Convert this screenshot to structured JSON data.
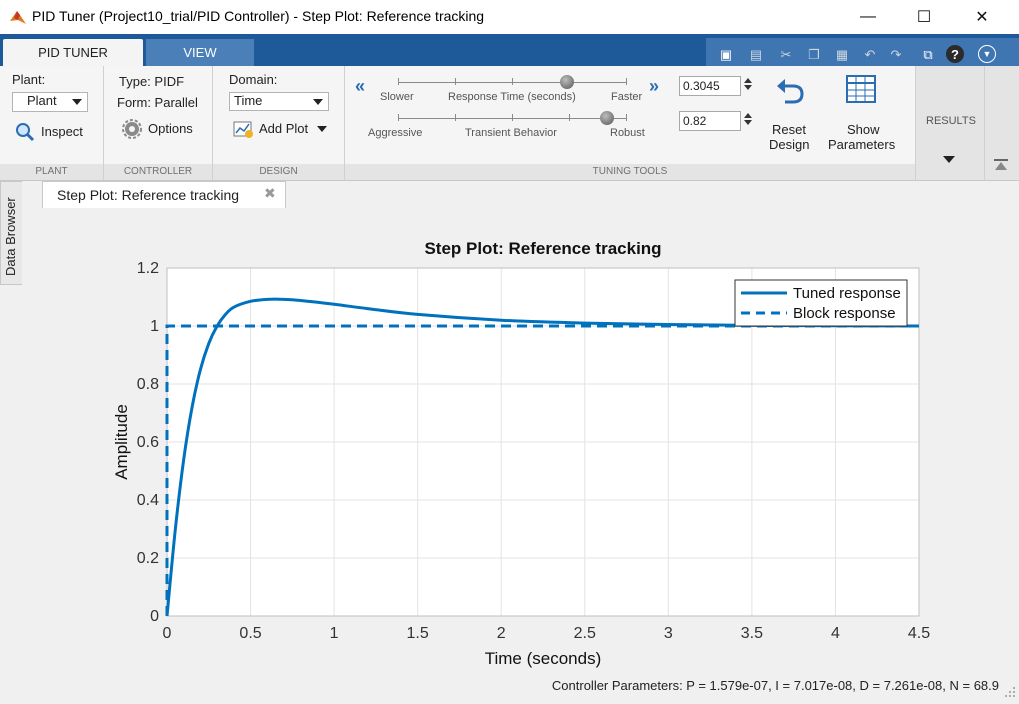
{
  "window": {
    "title": "PID Tuner (Project10_trial/PID Controller) - Step Plot: Reference tracking",
    "minimize": "—",
    "maximize": "☐",
    "close": "✕"
  },
  "tabs": {
    "pid_tuner": "PID TUNER",
    "view": "VIEW"
  },
  "plant": {
    "label": "Plant:",
    "value": "Plant",
    "inspect": "Inspect",
    "section": "PLANT"
  },
  "controller": {
    "type": "Type: PIDF",
    "form": "Form: Parallel",
    "options": "Options",
    "section": "CONTROLLER"
  },
  "design": {
    "domain_label": "Domain:",
    "domain_value": "Time",
    "add_plot": "Add Plot",
    "section": "DESIGN"
  },
  "tuning": {
    "slower": "Slower",
    "response_time": "Response Time (seconds)",
    "faster": "Faster",
    "aggressive": "Aggressive",
    "transient_behavior": "Transient Behavior",
    "robust": "Robust",
    "response_value": "0.3045",
    "transient_value": "0.82",
    "reset_design_1": "Reset",
    "reset_design_2": "Design",
    "show_params_1": "Show",
    "show_params_2": "Parameters",
    "section": "TUNING TOOLS"
  },
  "results": {
    "label": "RESULTS"
  },
  "data_browser": "Data Browser",
  "doc_tab": "Step Plot: Reference tracking",
  "controller_parameters": "Controller Parameters: P = 1.579e-07, I = 7.017e-08, D = 7.261e-08, N = 68.9",
  "colors": {
    "accent": "#1e5a9a",
    "series": "#0072bd"
  },
  "chart_data": {
    "type": "line",
    "title": "Step Plot: Reference tracking",
    "xlabel": "Time (seconds)",
    "ylabel": "Amplitude",
    "xlim": [
      0,
      4.5
    ],
    "ylim": [
      0,
      1.2
    ],
    "xticks": [
      "0",
      "0.5",
      "1",
      "1.5",
      "2",
      "2.5",
      "3",
      "3.5",
      "4",
      "4.5"
    ],
    "yticks": [
      "0",
      "0.2",
      "0.4",
      "0.6",
      "0.8",
      "1",
      "1.2"
    ],
    "grid": true,
    "legend_position": "top-right",
    "series": [
      {
        "name": "Tuned response",
        "style": "solid",
        "x": [
          0,
          0.05,
          0.1,
          0.15,
          0.2,
          0.25,
          0.3,
          0.35,
          0.4,
          0.5,
          0.6,
          0.7,
          0.8,
          1.0,
          1.2,
          1.5,
          2.0,
          2.5,
          3.0,
          3.5,
          4.0,
          4.5
        ],
        "y": [
          0,
          0.3,
          0.54,
          0.72,
          0.85,
          0.94,
          1.0,
          1.04,
          1.065,
          1.085,
          1.092,
          1.092,
          1.088,
          1.075,
          1.06,
          1.04,
          1.02,
          1.01,
          1.005,
          1.002,
          1.001,
          1.0
        ]
      },
      {
        "name": "Block response",
        "style": "dashed",
        "x": [
          0,
          0,
          4.5
        ],
        "y": [
          0,
          1,
          1
        ]
      }
    ]
  }
}
